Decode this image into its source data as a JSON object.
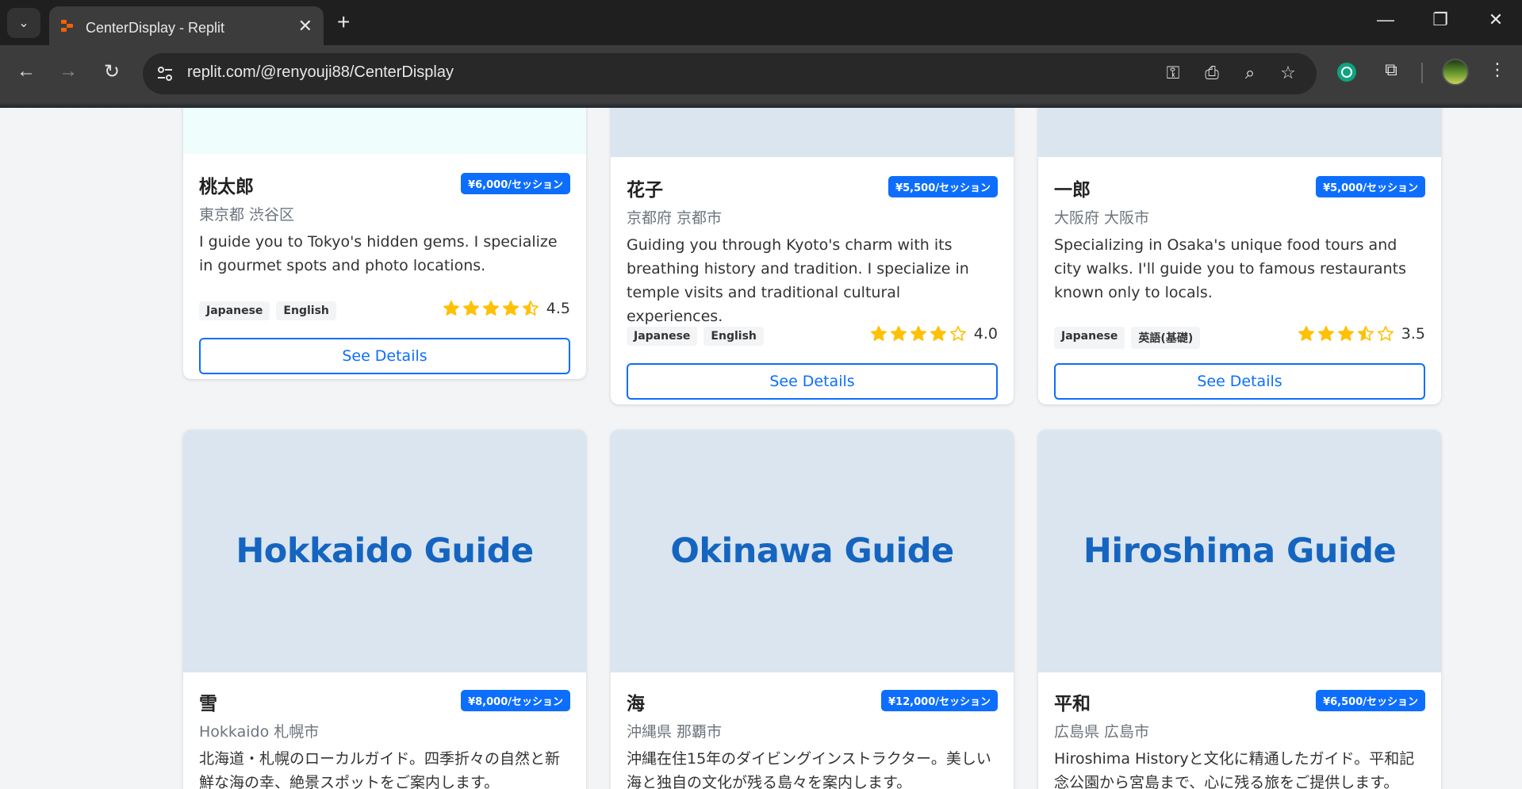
{
  "browser": {
    "tab_title": "CenterDisplay - Replit",
    "url": "replit.com/@renyouji88/CenterDisplay"
  },
  "cards": [
    {
      "name": "桃太郎",
      "price": "¥6,000/セッション",
      "location": "東京都 渋谷区",
      "description": "I guide you to Tokyo's hidden gems. I specialize in gourmet spots and photo locations.",
      "languages": [
        "Japanese",
        "English"
      ],
      "rating": 4.5,
      "rating_text": "4.5",
      "button": "See Details"
    },
    {
      "name": "花子",
      "price": "¥5,500/セッション",
      "location": "京都府 京都市",
      "description": "Guiding you through Kyoto's charm with its breathing history and tradition. I specialize in temple visits and traditional cultural experiences.",
      "languages": [
        "Japanese",
        "English"
      ],
      "rating": 4.0,
      "rating_text": "4.0",
      "button": "See Details"
    },
    {
      "name": "一郎",
      "price": "¥5,000/セッション",
      "location": "大阪府 大阪市",
      "description": "Specializing in Osaka's unique food tours and city walks. I'll guide you to famous restaurants known only to locals.",
      "languages": [
        "Japanese",
        "英語(基礎)"
      ],
      "rating": 3.5,
      "rating_text": "3.5",
      "button": "See Details"
    },
    {
      "image_text": "Hokkaido Guide",
      "name": "雪",
      "price": "¥8,000/セッション",
      "location": "Hokkaido 札幌市",
      "description": "北海道・札幌のローカルガイド。四季折々の自然と新鮮な海の幸、絶景スポットをご案内します。"
    },
    {
      "image_text": "Okinawa Guide",
      "name": "海",
      "price": "¥12,000/セッション",
      "location": "沖縄県 那覇市",
      "description": "沖縄在住15年のダイビングインストラクター。美しい海と独自の文化が残る島々を案内します。"
    },
    {
      "image_text": "Hiroshima Guide",
      "name": "平和",
      "price": "¥6,500/セッション",
      "location": "広島県 広島市",
      "description": "Hiroshima Historyと文化に精通したガイド。平和記念公園から宮島まで、心に残る旅をご提供します。"
    }
  ]
}
